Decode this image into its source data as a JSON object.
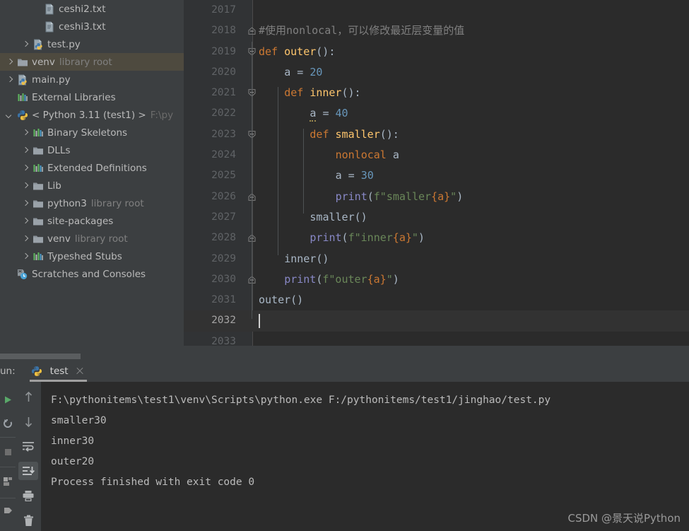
{
  "project_tree": {
    "items": [
      {
        "arrow": "none",
        "icon": "text-file-icon",
        "label": "ceshi2.txt",
        "sub": "",
        "indent": 46,
        "selected": false
      },
      {
        "arrow": "none",
        "icon": "text-file-icon",
        "label": "ceshi3.txt",
        "sub": "",
        "indent": 46,
        "selected": false
      },
      {
        "arrow": "right",
        "icon": "python-file-icon",
        "label": "test.py",
        "sub": "",
        "indent": 30,
        "selected": false
      },
      {
        "arrow": "right",
        "icon": "folder-icon",
        "label": "venv",
        "sub": "library root",
        "indent": 8,
        "selected": true
      },
      {
        "arrow": "right",
        "icon": "python-file-icon",
        "label": "main.py",
        "sub": "",
        "indent": 8,
        "selected": false
      },
      {
        "arrow": "none",
        "icon": "library-icon",
        "label": "External Libraries",
        "sub": "",
        "indent": 8,
        "selected": false
      },
      {
        "arrow": "down",
        "icon": "python-icon",
        "label": "< Python 3.11 (test1) >",
        "sub": "",
        "path": "F:\\py",
        "indent": 8,
        "selected": false
      },
      {
        "arrow": "right",
        "icon": "library-icon",
        "label": "Binary Skeletons",
        "sub": "",
        "indent": 30,
        "selected": false
      },
      {
        "arrow": "right",
        "icon": "folder-icon",
        "label": "DLLs",
        "sub": "",
        "indent": 30,
        "selected": false
      },
      {
        "arrow": "right",
        "icon": "library-icon",
        "label": "Extended Definitions",
        "sub": "",
        "indent": 30,
        "selected": false
      },
      {
        "arrow": "right",
        "icon": "folder-icon",
        "label": "Lib",
        "sub": "",
        "indent": 30,
        "selected": false
      },
      {
        "arrow": "right",
        "icon": "folder-icon",
        "label": "python3",
        "sub": "library root",
        "indent": 30,
        "selected": false
      },
      {
        "arrow": "right",
        "icon": "folder-icon",
        "label": "site-packages",
        "sub": "",
        "indent": 30,
        "selected": false
      },
      {
        "arrow": "right",
        "icon": "folder-icon",
        "label": "venv",
        "sub": "library root",
        "indent": 30,
        "selected": false
      },
      {
        "arrow": "right",
        "icon": "library-icon",
        "label": "Typeshed Stubs",
        "sub": "",
        "indent": 30,
        "selected": false
      },
      {
        "arrow": "none",
        "icon": "scratches-icon",
        "label": "Scratches and Consoles",
        "sub": "",
        "indent": 8,
        "selected": false
      }
    ]
  },
  "editor": {
    "lines": [
      {
        "no": "2017",
        "indent": 0,
        "fold": "",
        "current": false,
        "tokens": []
      },
      {
        "no": "2018",
        "indent": 0,
        "fold": "bottom",
        "current": false,
        "tokens": [
          {
            "t": "#使用nonlocal，可以修改最近层变量的值",
            "c": "cmt"
          }
        ]
      },
      {
        "no": "2019",
        "indent": 0,
        "fold": "open",
        "current": false,
        "tokens": [
          {
            "t": "def ",
            "c": "kw"
          },
          {
            "t": "outer",
            "c": "fn"
          },
          {
            "t": "():",
            "c": "pun"
          }
        ]
      },
      {
        "no": "2020",
        "indent": 1,
        "fold": "",
        "current": false,
        "tokens": [
          {
            "t": "a = ",
            "c": "var"
          },
          {
            "t": "20",
            "c": "num"
          }
        ]
      },
      {
        "no": "2021",
        "indent": 1,
        "fold": "open",
        "current": false,
        "tokens": [
          {
            "t": "def ",
            "c": "kw"
          },
          {
            "t": "inner",
            "c": "fn"
          },
          {
            "t": "():",
            "c": "pun"
          }
        ]
      },
      {
        "no": "2022",
        "indent": 2,
        "fold": "",
        "current": false,
        "tokens": [
          {
            "t": "a",
            "c": "warnvar"
          },
          {
            "t": " = ",
            "c": "var"
          },
          {
            "t": "40",
            "c": "num"
          }
        ]
      },
      {
        "no": "2023",
        "indent": 2,
        "fold": "open",
        "current": false,
        "tokens": [
          {
            "t": "def ",
            "c": "kw"
          },
          {
            "t": "smaller",
            "c": "fn"
          },
          {
            "t": "():",
            "c": "pun"
          }
        ]
      },
      {
        "no": "2024",
        "indent": 3,
        "fold": "",
        "current": false,
        "tokens": [
          {
            "t": "nonlocal ",
            "c": "kw"
          },
          {
            "t": "a",
            "c": "var"
          }
        ]
      },
      {
        "no": "2025",
        "indent": 3,
        "fold": "",
        "current": false,
        "tokens": [
          {
            "t": "a = ",
            "c": "var"
          },
          {
            "t": "30",
            "c": "num"
          }
        ]
      },
      {
        "no": "2026",
        "indent": 3,
        "fold": "bottom",
        "current": false,
        "tokens": [
          {
            "t": "print",
            "c": "pfn"
          },
          {
            "t": "(",
            "c": "pun"
          },
          {
            "t": "f\"smaller",
            "c": "str"
          },
          {
            "t": "{a}",
            "c": "brc"
          },
          {
            "t": "\"",
            "c": "str"
          },
          {
            "t": ")",
            "c": "pun"
          }
        ]
      },
      {
        "no": "2027",
        "indent": 2,
        "fold": "",
        "current": false,
        "tokens": [
          {
            "t": "smaller()",
            "c": "var"
          }
        ]
      },
      {
        "no": "2028",
        "indent": 2,
        "fold": "bottom",
        "current": false,
        "tokens": [
          {
            "t": "print",
            "c": "pfn"
          },
          {
            "t": "(",
            "c": "pun"
          },
          {
            "t": "f\"inner",
            "c": "str"
          },
          {
            "t": "{a}",
            "c": "brc"
          },
          {
            "t": "\"",
            "c": "str"
          },
          {
            "t": ")",
            "c": "pun"
          }
        ]
      },
      {
        "no": "2029",
        "indent": 1,
        "fold": "",
        "current": false,
        "tokens": [
          {
            "t": "inner()",
            "c": "var"
          }
        ]
      },
      {
        "no": "2030",
        "indent": 1,
        "fold": "bottom",
        "current": false,
        "tokens": [
          {
            "t": "print",
            "c": "pfn"
          },
          {
            "t": "(",
            "c": "pun"
          },
          {
            "t": "f\"outer",
            "c": "str"
          },
          {
            "t": "{a}",
            "c": "brc"
          },
          {
            "t": "\"",
            "c": "str"
          },
          {
            "t": ")",
            "c": "pun"
          }
        ]
      },
      {
        "no": "2031",
        "indent": 0,
        "fold": "",
        "current": false,
        "tokens": [
          {
            "t": "outer()",
            "c": "var"
          }
        ]
      },
      {
        "no": "2032",
        "indent": 0,
        "fold": "",
        "current": true,
        "tokens": []
      },
      {
        "no": "2033",
        "indent": 0,
        "fold": "",
        "current": false,
        "tokens": []
      }
    ]
  },
  "run_panel": {
    "label": "un:",
    "tab_name": "test",
    "tab_icon": "python-icon",
    "toolbar": [
      {
        "name": "scroll-up-icon",
        "active": false
      },
      {
        "name": "scroll-down-icon",
        "active": false
      },
      {
        "name": "soft-wrap-icon",
        "active": false
      },
      {
        "name": "scroll-to-end-icon",
        "active": true
      },
      {
        "name": "print-icon",
        "active": false
      },
      {
        "name": "trash-icon",
        "active": false
      }
    ],
    "left_rail": [
      {
        "name": "rerun-icon"
      },
      {
        "name": "restart-icon"
      },
      {
        "name": "stop-icon"
      },
      {
        "name": "layout-icon"
      },
      {
        "name": "pin-icon"
      }
    ],
    "console_lines": [
      "F:\\pythonitems\\test1\\venv\\Scripts\\python.exe F:/pythonitems/test1/jinghao/test.py",
      "smaller30",
      "inner30",
      "outer20",
      "",
      "Process finished with exit code 0"
    ]
  },
  "watermark": "CSDN @景天说Python",
  "colors": {
    "panel_bg": "#3c3f41",
    "editor_bg": "#2b2b2b",
    "gutter_bg": "#313335",
    "selection_bg": "#4e4a3f",
    "keyword": "#cc7832",
    "function": "#ffc66d",
    "number": "#6897bb",
    "string": "#6a8759",
    "comment": "#808080",
    "print_fn": "#8888c6",
    "text": "#a9b7c6"
  }
}
